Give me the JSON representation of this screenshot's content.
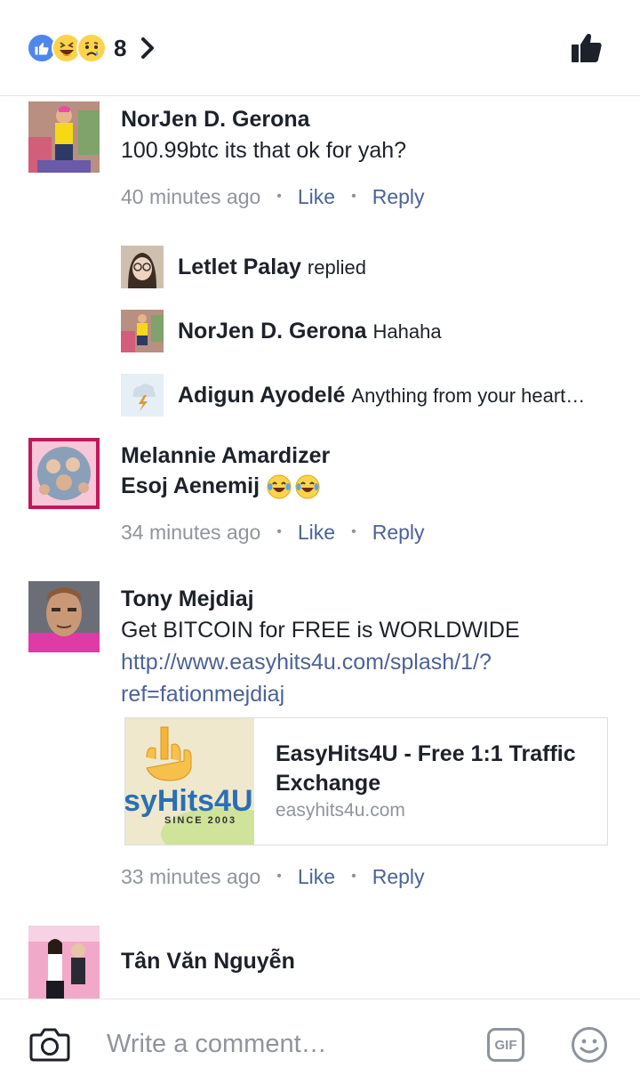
{
  "header": {
    "reaction_count": "8",
    "reactions": [
      "like-icon",
      "haha-icon",
      "sad-icon"
    ]
  },
  "comments": [
    {
      "author": "NorJen D. Gerona",
      "text": "100.99btc its that ok for yah?",
      "time": "40 minutes ago",
      "like_label": "Like",
      "reply_label": "Reply",
      "replies": [
        {
          "author": "Letlet Palay",
          "text": "replied"
        },
        {
          "author": "NorJen D. Gerona",
          "text": "Hahaha"
        },
        {
          "author": "Adigun Ayodelé",
          "text": "Anything from your heart…"
        }
      ]
    },
    {
      "author": "Melannie Amardizer",
      "text": "Esoj Aenemij",
      "time": "34 minutes ago",
      "like_label": "Like",
      "reply_label": "Reply"
    },
    {
      "author": "Tony Mejdiaj",
      "text": "Get BITCOIN for FREE is WORLDWIDE",
      "link_line1": "http://www.easyhits4u.com/splash/1/?",
      "link_line2": "ref=fationmejdiaj",
      "card": {
        "title": "EasyHits4U - Free 1:1 Traffic Exchange",
        "domain": "easyhits4u.com",
        "logo_text": "syHits4U",
        "logo_since": "SINCE 2003"
      },
      "time": "33 minutes ago",
      "like_label": "Like",
      "reply_label": "Reply"
    },
    {
      "author": "Tân Văn Nguyễn"
    }
  ],
  "composer": {
    "placeholder": "Write a comment…",
    "gif_label": "GIF"
  },
  "colors": {
    "link": "#4b6396",
    "meta": "#90949c",
    "text": "#1d2129",
    "like_blue": "#4e86ec"
  }
}
